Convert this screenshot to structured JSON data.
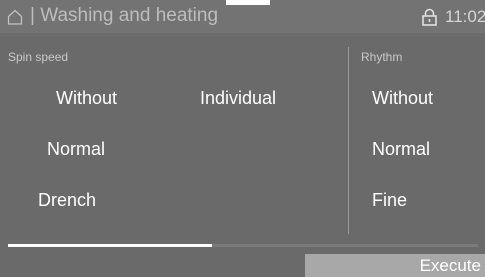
{
  "header": {
    "icon": "home-icon",
    "title": "| Washing and heating",
    "lock_icon": "lock-icon",
    "time": "11:02"
  },
  "spin_speed": {
    "label": "Spin speed",
    "options": [
      "Without",
      "Individual",
      "Normal",
      "Drench"
    ]
  },
  "rhythm": {
    "label": "Rhythm",
    "options": [
      "Without",
      "Normal",
      "Fine"
    ]
  },
  "progress": {
    "fraction": 0.435
  },
  "footer": {
    "execute_label": "Execute"
  },
  "colors": {
    "background": "#6a6a6a",
    "header_background": "#737373",
    "button_background": "#a8a8a8",
    "text": "#ffffff"
  }
}
